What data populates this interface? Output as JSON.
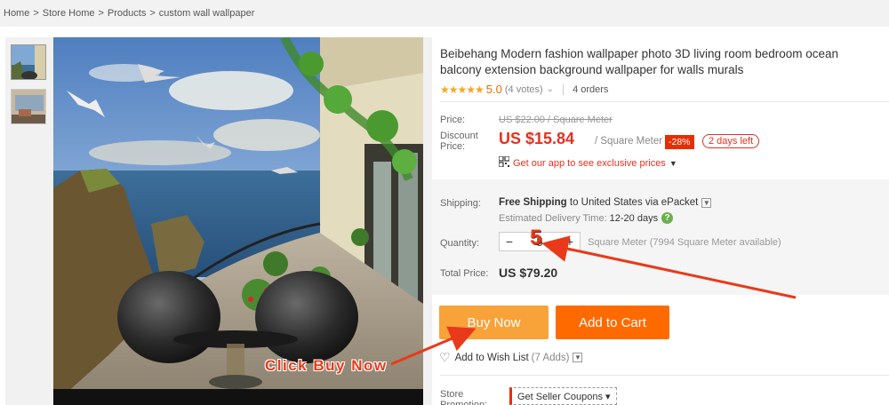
{
  "breadcrumb": [
    "Home",
    "Store Home",
    "Products",
    "custom wall wallpaper"
  ],
  "product": {
    "title": "Beibehang Modern fashion wallpaper photo 3D living room bedroom ocean balcony extension background wallpaper for walls murals",
    "stars": "★★★★★",
    "rating": "5.0",
    "votes": "(4 votes)",
    "orders": "4 orders"
  },
  "price": {
    "label": "Price:",
    "original": "US $22.00 / Square Meter",
    "discount_label": "Discount Price:",
    "current": "US $15.84",
    "unit": "/ Square Meter",
    "discount_badge": "-28%",
    "time_left": "2 days left",
    "app_promo": "Get our app to see exclusive prices"
  },
  "shipping": {
    "label": "Shipping:",
    "free": "Free Shipping",
    "to_text": "to United States via ePacket",
    "est_label": "Estimated Delivery Time:",
    "est_value": "12-20 days"
  },
  "quantity": {
    "label": "Quantity:",
    "minus": "−",
    "value": "5",
    "plus": "+",
    "available": "Square Meter (7994 Square Meter available)"
  },
  "total": {
    "label": "Total Price:",
    "value": "US $79.20"
  },
  "actions": {
    "buy_now": "Buy Now",
    "add_to_cart": "Add to Cart",
    "wishlist": "Add to Wish List",
    "wishlist_count": "(7 Adds)"
  },
  "store_promo": {
    "label": "Store Promotion:",
    "coupon": "Get Seller Coupons ▾"
  },
  "annotations": {
    "click_text": "Click Buy Now",
    "qty_callout": "5"
  },
  "colors": {
    "price_red": "#e5311e",
    "buy_now": "#f8a23a",
    "add_to_cart": "#ff6a00",
    "annotation": "#e83a1a"
  }
}
